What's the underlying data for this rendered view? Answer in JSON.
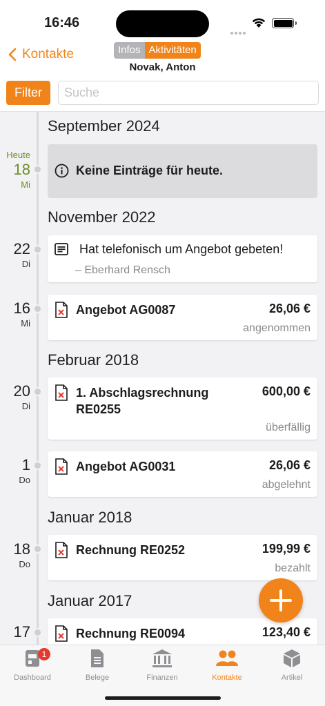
{
  "status": {
    "time": "16:46"
  },
  "nav": {
    "back_label": "Kontakte",
    "segments": [
      "Infos",
      "Aktivitäten"
    ],
    "active_segment": "Aktivitäten",
    "contact_name": "Novak, Anton"
  },
  "toolbar": {
    "filter_label": "Filter",
    "search_placeholder": "Suche"
  },
  "timeline": {
    "months": [
      "September 2024",
      "November 2022",
      "Februar 2018",
      "Januar 2018",
      "Januar 2017"
    ],
    "today": {
      "prefix": "Heute",
      "day": "18",
      "weekday": "Mi",
      "message": "Keine Einträge für heute."
    },
    "entries": [
      {
        "day": "22",
        "weekday": "Di",
        "type": "note",
        "title": "Hat telefonisch um Angebot gebeten!",
        "author": "– Eberhard Rensch"
      },
      {
        "day": "16",
        "weekday": "Mi",
        "type": "document",
        "title": "Angebot AG0087",
        "amount": "26,06 €",
        "status": "angenommen"
      },
      {
        "day": "20",
        "weekday": "Di",
        "type": "document",
        "title": "1. Abschlagsrechnung RE0255",
        "amount": "600,00 €",
        "status": "überfällig"
      },
      {
        "day": "1",
        "weekday": "Do",
        "type": "document",
        "title": "Angebot AG0031",
        "amount": "26,06 €",
        "status": "abgelehnt"
      },
      {
        "day": "18",
        "weekday": "Do",
        "type": "document",
        "title": "Rechnung RE0252",
        "amount": "199,99 €",
        "status": "bezahlt"
      },
      {
        "day": "17",
        "weekday": "",
        "type": "document",
        "title": "Rechnung RE0094",
        "amount": "123,40 €",
        "status": ""
      }
    ]
  },
  "tabs": [
    {
      "label": "Dashboard",
      "icon": "dashboard-icon",
      "badge": "1"
    },
    {
      "label": "Belege",
      "icon": "document-icon"
    },
    {
      "label": "Finanzen",
      "icon": "bank-icon"
    },
    {
      "label": "Kontakte",
      "icon": "contacts-icon",
      "active": true
    },
    {
      "label": "Artikel",
      "icon": "box-icon"
    }
  ],
  "colors": {
    "accent": "#f0841a",
    "today": "#6b8e23",
    "badge": "#e63a2f"
  }
}
